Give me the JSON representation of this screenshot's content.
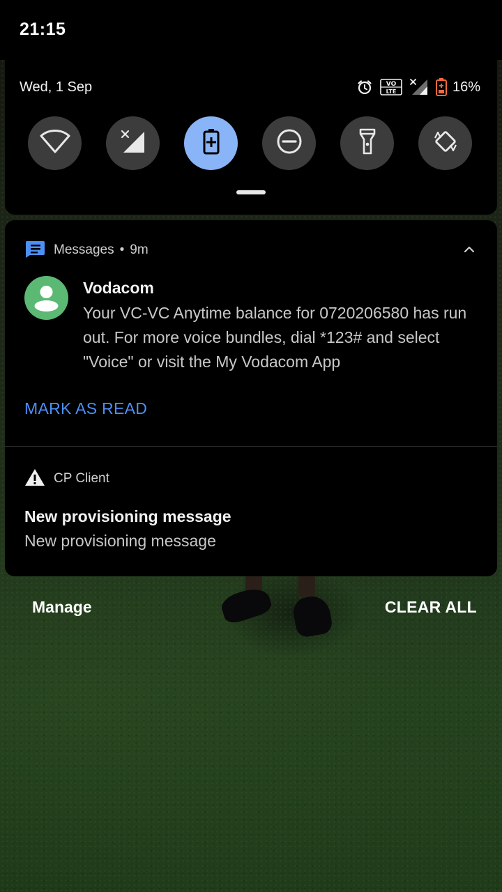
{
  "status_bar": {
    "time": "21:15"
  },
  "quick_settings": {
    "date": "Wed, 1 Sep",
    "status_icons": {
      "alarm": "alarm-icon",
      "volte_top": "VO",
      "volte_bottom": "LTE",
      "signal": "cell-signal-no-data-icon",
      "battery": "battery-low-icon"
    },
    "battery_percent": "16%",
    "battery_color": "#f06a3c",
    "accent": "#8ab4f8",
    "tiles": [
      {
        "name": "wifi",
        "icon": "wifi-icon",
        "active": false
      },
      {
        "name": "mobile-data",
        "icon": "cell-signal-icon",
        "active": false
      },
      {
        "name": "battery-saver",
        "icon": "battery-saver-icon",
        "active": true
      },
      {
        "name": "do-not-disturb",
        "icon": "dnd-icon",
        "active": false
      },
      {
        "name": "flashlight",
        "icon": "flashlight-icon",
        "active": false
      },
      {
        "name": "auto-rotate",
        "icon": "auto-rotate-icon",
        "active": false
      }
    ]
  },
  "notifications": {
    "messages": {
      "app_name": "Messages",
      "separator": "•",
      "time": "9m",
      "app_icon_color": "#4e8ff5",
      "sender": "Vodacom",
      "body": "Your VC-VC Anytime balance for 0720206580 has run out. For more voice bundles, dial *123# and select \"Voice\" or visit the My Vodacom App",
      "action": "MARK AS READ",
      "action_color": "#4e8ff5",
      "avatar_color": "#5bb974"
    },
    "cp_client": {
      "app_name": "CP Client",
      "title": "New provisioning message",
      "text": "New provisioning message"
    }
  },
  "footer": {
    "manage": "Manage",
    "clear_all": "CLEAR ALL"
  }
}
